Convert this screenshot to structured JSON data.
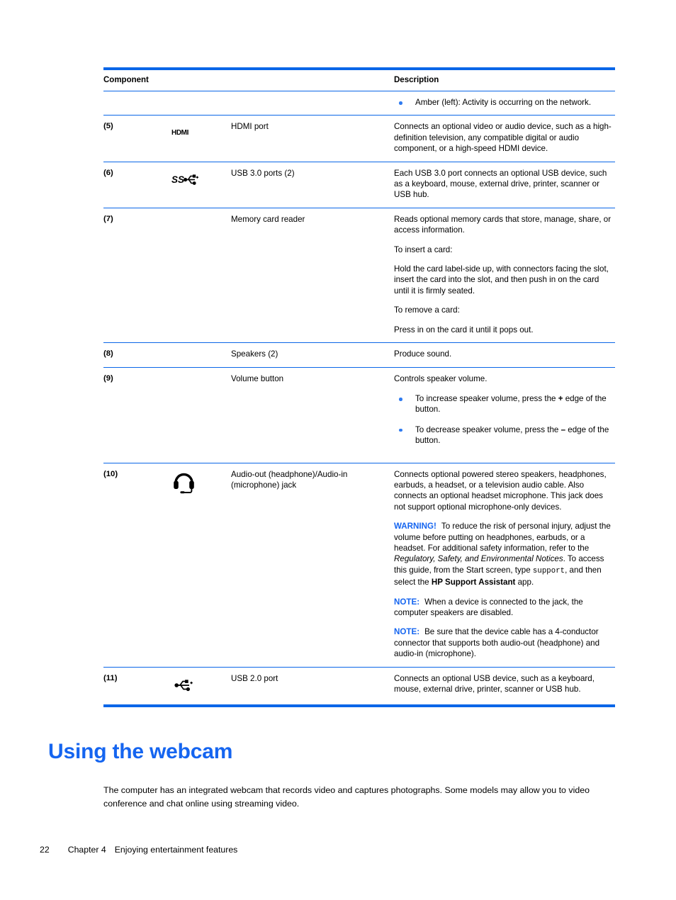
{
  "table": {
    "headers": {
      "component": "Component",
      "description": "Description"
    },
    "rows": [
      {
        "num": "",
        "icon": "",
        "name": "",
        "desc_bullets": [
          "Amber (left): Activity is occurring on the network."
        ]
      },
      {
        "num": "(5)",
        "icon": "hdmi-icon",
        "icon_text": "HDMI",
        "name": "HDMI port",
        "desc": "Connects an optional video or audio device, such as a high-definition television, any compatible digital or audio component, or a high-speed HDMI device."
      },
      {
        "num": "(6)",
        "icon": "usb-superspeed-icon",
        "name": "USB 3.0 ports (2)",
        "desc": "Each USB 3.0 port connects an optional USB device, such as a keyboard, mouse, external drive, printer, scanner or USB hub."
      },
      {
        "num": "(7)",
        "icon": "memory-card-icon",
        "name": "Memory card reader",
        "desc_paras": [
          "Reads optional memory cards that store, manage, share, or access information.",
          "To insert a card:",
          "Hold the card label-side up, with connectors facing the slot, insert the card into the slot, and then push in on the card until it is firmly seated.",
          "To remove a card:",
          "Press in on the card it until it pops out."
        ]
      },
      {
        "num": "(8)",
        "icon": "",
        "name": "Speakers (2)",
        "desc": "Produce sound."
      },
      {
        "num": "(9)",
        "icon": "",
        "name": "Volume button",
        "desc_lead": "Controls speaker volume.",
        "desc_bullets_parts": [
          {
            "pre": "To increase speaker volume, press the ",
            "sym": "+",
            "post": " edge of the button."
          },
          {
            "pre": "To decrease speaker volume, press the ",
            "sym": "–",
            "post": " edge of the button."
          }
        ]
      },
      {
        "num": "(10)",
        "icon": "headset-icon",
        "name": "Audio-out (headphone)/Audio-in (microphone) jack",
        "desc_paras": [
          "Connects optional powered stereo speakers, headphones, earbuds, a headset, or a television audio cable. Also connects an optional headset microphone. This jack does not support optional microphone-only devices."
        ],
        "warning": {
          "label": "WARNING!",
          "text_1": "To reduce the risk of personal injury, adjust the volume before putting on headphones, earbuds, or a headset. For additional safety information, refer to the ",
          "italic_title": "Regulatory, Safety, and Environmental Notices",
          "text_2": ". To access this guide, from the Start screen, type ",
          "mono": "support",
          "text_3": ", and then select the ",
          "bold_app": "HP Support Assistant",
          "text_4": " app."
        },
        "notes": [
          {
            "label": "NOTE:",
            "text": "When a device is connected to the jack, the computer speakers are disabled."
          },
          {
            "label": "NOTE:",
            "text": "Be sure that the device cable has a 4-conductor connector that supports both audio-out (headphone) and audio-in (microphone)."
          }
        ]
      },
      {
        "num": "(11)",
        "icon": "usb-icon",
        "name": "USB 2.0 port",
        "desc": "Connects an optional USB device, such as a keyboard, mouse, external drive, printer, scanner or USB hub."
      }
    ]
  },
  "section": {
    "heading": "Using the webcam",
    "paragraph": "The computer has an integrated webcam that records video and captures photographs. Some models may allow you to video conference and chat online using streaming video."
  },
  "footer": {
    "page_number": "22",
    "chapter": "Chapter 4",
    "chapter_title": "Enjoying entertainment features"
  },
  "colors": {
    "accent_blue": "#0a66e8",
    "heading_blue": "#1565f0",
    "bullet_blue": "#2f7bf0"
  }
}
